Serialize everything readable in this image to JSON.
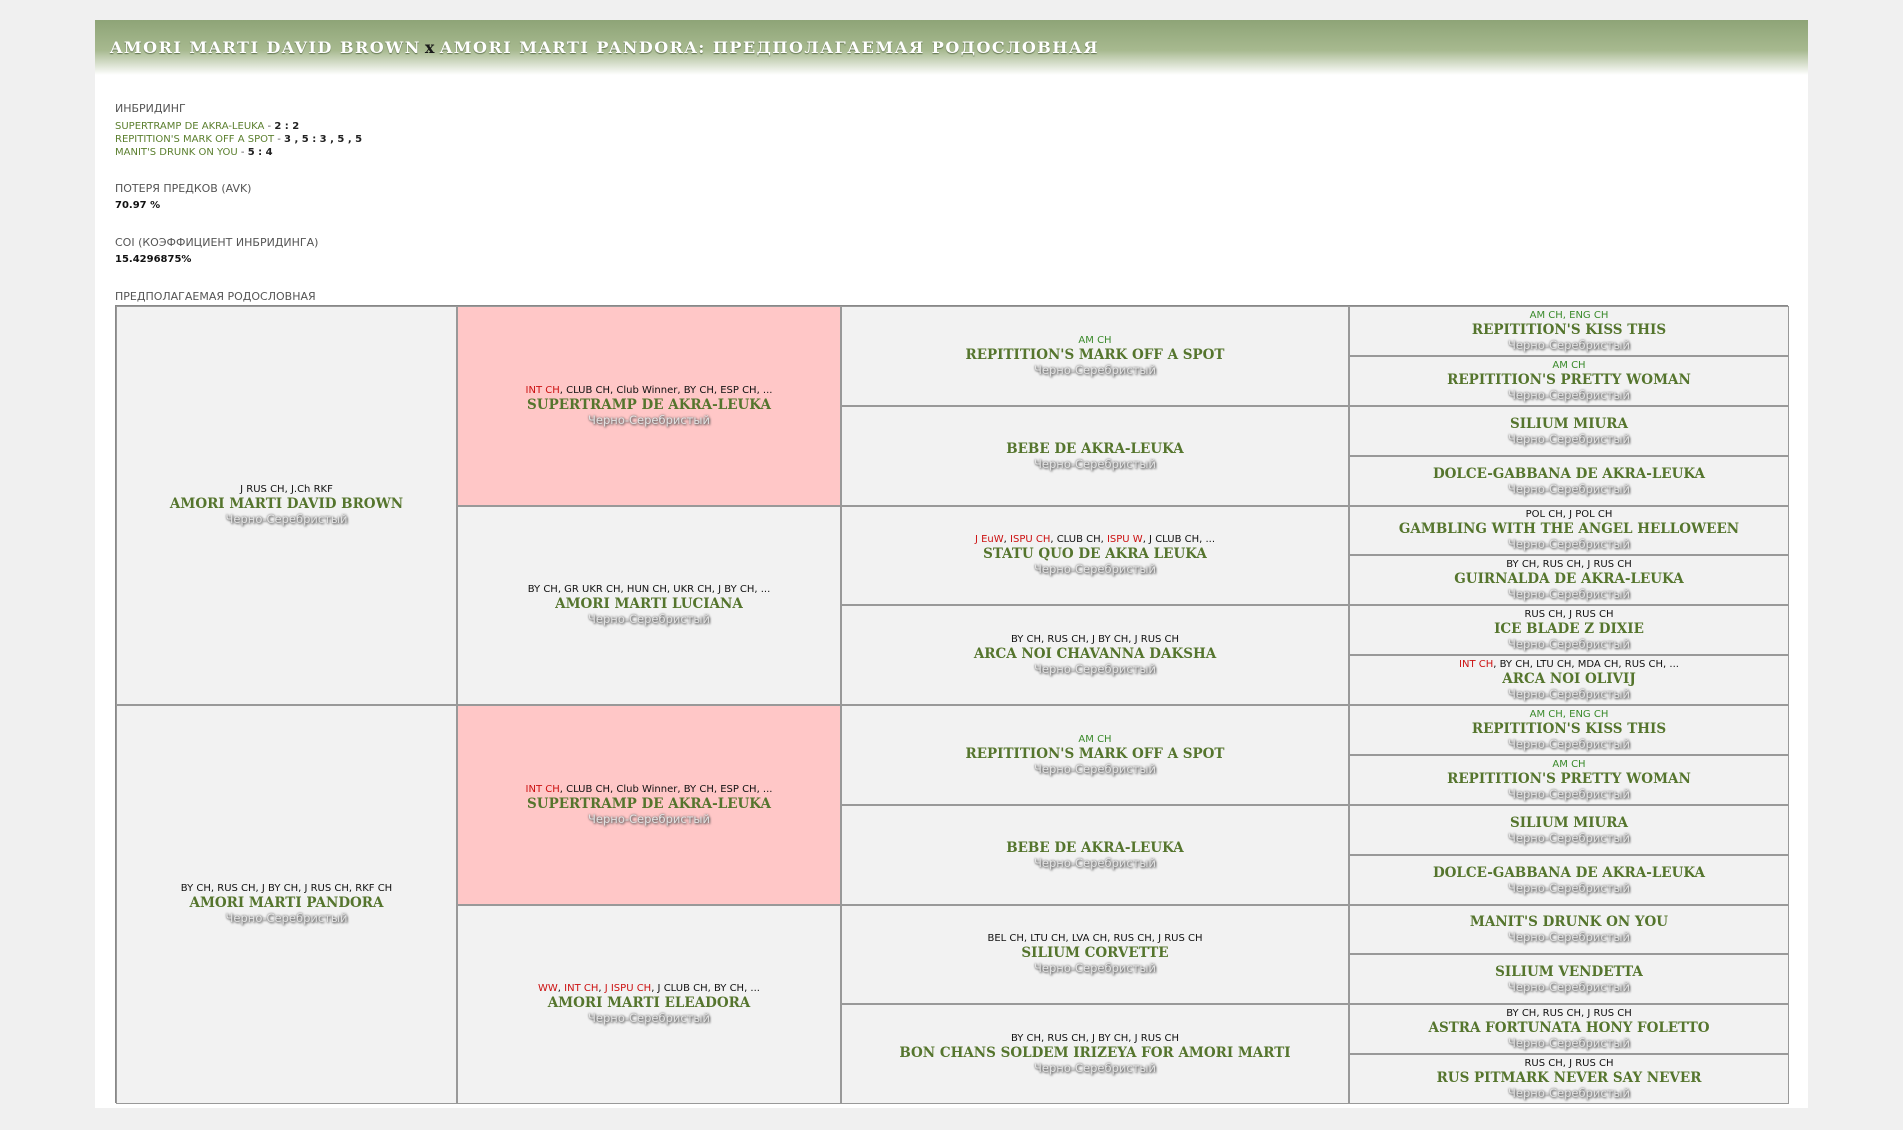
{
  "header": {
    "sire": "AMORI MARTI DAVID BROWN",
    "x": "x",
    "rest": "AMORI MARTI PANDORA: ПРЕДПОЛАГАЕМАЯ РОДОСЛОВНАЯ"
  },
  "inbreeding": {
    "title": "ИНБРИДИНГ",
    "items": [
      {
        "name": "SUPERTRAMP DE AKRA-LEUKA",
        "sep": " - ",
        "value": "2 : 2"
      },
      {
        "name": "REPITITION'S MARK OFF A SPOT",
        "sep": " - ",
        "value": "3 , 5 : 3 , 5 , 5"
      },
      {
        "name": "MANIT'S DRUNK ON YOU",
        "sep": " - ",
        "value": "5 : 4"
      }
    ]
  },
  "avk": {
    "title": "ПОТЕРЯ ПРЕДКОВ (AVK)",
    "value": "70.97 %"
  },
  "coi": {
    "title": "COI (КОЭФФИЦИЕНТ ИНБРИДИНГА)",
    "value": "15.4296875%"
  },
  "pedigree": {
    "title": "ПРЕДПОЛАГАЕМАЯ РОДОСЛОВНАЯ",
    "cells": [
      {
        "titles": [
          {
            "t": "J RUS CH, J.Ch RKF",
            "c": "black"
          }
        ],
        "name": "AMORI MARTI DAVID BROWN",
        "color": "Черно-Серебристый"
      },
      {
        "titles": [
          {
            "t": "BY CH, RUS CH, J BY CH, J RUS CH, RKF CH",
            "c": "black"
          }
        ],
        "name": "AMORI MARTI PANDORA",
        "color": "Черно-Серебристый"
      },
      {
        "titles": [
          {
            "t": "INT CH",
            "c": "red"
          },
          {
            "t": ", CLUB CH, Club Winner, BY CH, ESP CH, ...",
            "c": "black"
          }
        ],
        "name": "SUPERTRAMP DE AKRA-LEUKA",
        "color": "Черно-Серебристый",
        "pink": true
      },
      {
        "titles": [
          {
            "t": "BY CH, GR UKR CH, HUN CH, UKR CH, J BY CH, ...",
            "c": "black"
          }
        ],
        "name": "AMORI MARTI LUCIANA",
        "color": "Черно-Серебристый"
      },
      {
        "titles": [
          {
            "t": "INT CH",
            "c": "red"
          },
          {
            "t": ", CLUB CH, Club Winner, BY CH, ESP CH, ...",
            "c": "black"
          }
        ],
        "name": "SUPERTRAMP DE AKRA-LEUKA",
        "color": "Черно-Серебристый",
        "pink": true
      },
      {
        "titles": [
          {
            "t": "WW",
            "c": "red"
          },
          {
            "t": ", ",
            "c": "black"
          },
          {
            "t": "INT CH",
            "c": "red"
          },
          {
            "t": ", ",
            "c": "black"
          },
          {
            "t": "J ISPU CH",
            "c": "red"
          },
          {
            "t": ", J CLUB CH, BY CH, ...",
            "c": "black"
          }
        ],
        "name": "AMORI MARTI ELEADORA",
        "color": "Черно-Серебристый"
      },
      {
        "titles": [
          {
            "t": "AM CH",
            "c": "green"
          }
        ],
        "name": "REPITITION'S MARK OFF A SPOT",
        "color": "Черно-Серебристый"
      },
      {
        "titles": [],
        "name": "BEBE DE AKRA-LEUKA",
        "color": "Черно-Серебристый"
      },
      {
        "titles": [
          {
            "t": "J EuW",
            "c": "red"
          },
          {
            "t": ", ",
            "c": "black"
          },
          {
            "t": "ISPU CH",
            "c": "red"
          },
          {
            "t": ", CLUB CH, ",
            "c": "black"
          },
          {
            "t": "ISPU W",
            "c": "red"
          },
          {
            "t": ", J CLUB CH, ...",
            "c": "black"
          }
        ],
        "name": "STATU QUO DE AKRA LEUKA",
        "color": "Черно-Серебристый"
      },
      {
        "titles": [
          {
            "t": "BY CH, RUS CH, J BY CH, J RUS CH",
            "c": "black"
          }
        ],
        "name": "ARCA NOI CHAVANNA DAKSHA",
        "color": "Черно-Серебристый"
      },
      {
        "titles": [
          {
            "t": "AM CH",
            "c": "green"
          }
        ],
        "name": "REPITITION'S MARK OFF A SPOT",
        "color": "Черно-Серебристый"
      },
      {
        "titles": [],
        "name": "BEBE DE AKRA-LEUKA",
        "color": "Черно-Серебристый"
      },
      {
        "titles": [
          {
            "t": "BEL CH, LTU CH, LVA CH, RUS CH, J RUS CH",
            "c": "black"
          }
        ],
        "name": "SILIUM CORVETTE",
        "color": "Черно-Серебристый"
      },
      {
        "titles": [
          {
            "t": "BY CH, RUS CH, J BY CH, J RUS CH",
            "c": "black"
          }
        ],
        "name": "BON CHANS SOLDEM IRIZEYA FOR AMORI MARTI",
        "color": "Черно-Серебристый"
      },
      {
        "titles": [
          {
            "t": "AM CH, ENG CH",
            "c": "green"
          }
        ],
        "name": "REPITITION'S KISS THIS",
        "color": "Черно-Серебристый"
      },
      {
        "titles": [
          {
            "t": "AM CH",
            "c": "green"
          }
        ],
        "name": "REPITITION'S PRETTY WOMAN",
        "color": "Черно-Серебристый"
      },
      {
        "titles": [],
        "name": "SILIUM MIURA",
        "color": "Черно-Серебристый"
      },
      {
        "titles": [],
        "name": "DOLCE-GABBANA DE AKRA-LEUKA",
        "color": "Черно-Серебристый"
      },
      {
        "titles": [
          {
            "t": "POL CH, J POL CH",
            "c": "black"
          }
        ],
        "name": "GAMBLING WITH THE ANGEL HELLOWEEN",
        "color": "Черно-Серебристый"
      },
      {
        "titles": [
          {
            "t": "BY CH, RUS CH, J RUS CH",
            "c": "black"
          }
        ],
        "name": "GUIRNALDA DE AKRA-LEUKA",
        "color": "Черно-Серебристый"
      },
      {
        "titles": [
          {
            "t": "RUS CH, J RUS CH",
            "c": "black"
          }
        ],
        "name": "ICE BLADE Z DIXIE",
        "color": "Черно-Серебристый"
      },
      {
        "titles": [
          {
            "t": "INT CH",
            "c": "red"
          },
          {
            "t": ", BY CH, LTU CH, MDA CH, RUS CH, ...",
            "c": "black"
          }
        ],
        "name": "ARCA NOI OLIVIJ",
        "color": "Черно-Серебристый"
      },
      {
        "titles": [
          {
            "t": "AM CH, ENG CH",
            "c": "green"
          }
        ],
        "name": "REPITITION'S KISS THIS",
        "color": "Черно-Серебристый"
      },
      {
        "titles": [
          {
            "t": "AM CH",
            "c": "green"
          }
        ],
        "name": "REPITITION'S PRETTY WOMAN",
        "color": "Черно-Серебристый"
      },
      {
        "titles": [],
        "name": "SILIUM MIURA",
        "color": "Черно-Серебристый"
      },
      {
        "titles": [],
        "name": "DOLCE-GABBANA DE AKRA-LEUKA",
        "color": "Черно-Серебристый"
      },
      {
        "titles": [],
        "name": "MANIT'S DRUNK ON YOU",
        "color": "Черно-Серебристый"
      },
      {
        "titles": [],
        "name": "SILIUM VENDETTA",
        "color": "Черно-Серебристый"
      },
      {
        "titles": [
          {
            "t": "BY CH, RUS CH, J RUS CH",
            "c": "black"
          }
        ],
        "name": "ASTRA FORTUNATA HONY FOLETTO",
        "color": "Черно-Серебристый"
      },
      {
        "titles": [
          {
            "t": "RUS CH, J RUS CH",
            "c": "black"
          }
        ],
        "name": "RUS PITMARK NEVER SAY NEVER",
        "color": "Черно-Серебристый"
      }
    ]
  }
}
